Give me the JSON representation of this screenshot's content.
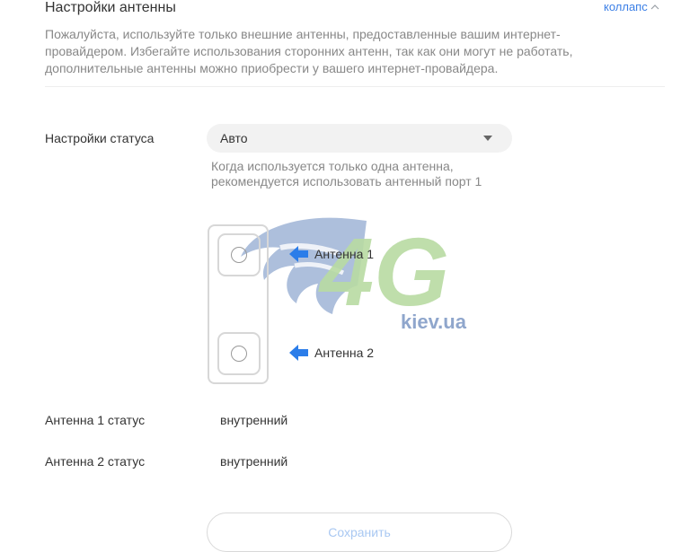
{
  "section": {
    "title": "Настройки антенны",
    "collapse_label": "коллапс",
    "description": "Пожалуйста, используйте только внешние антенны, предоставленные вашим интернет-провайдером. Избегайте использования сторонних антенн, так как они могут не работать, дополнительные антенны можно приобрести у вашего интернет-провайдера."
  },
  "status_setting": {
    "label": "Настройки статуса",
    "selected": "Авто",
    "hint": "Когда используется только одна антенна, рекомендуется использовать антенный порт 1"
  },
  "diagram": {
    "antenna1_label": "Антенна 1",
    "antenna2_label": "Антенна 2",
    "arrow_color": "#2b7de9"
  },
  "watermark": {
    "logo_text": "4G",
    "site": "kiev.ua"
  },
  "antenna_status": [
    {
      "label": "Антенна 1 статус",
      "value": "внутренний"
    },
    {
      "label": "Антенна 2 статус",
      "value": "внутренний"
    }
  ],
  "actions": {
    "save_label": "Сохранить"
  },
  "colors": {
    "accent": "#3b7fe6",
    "disabled_text": "#a9c8f2"
  }
}
